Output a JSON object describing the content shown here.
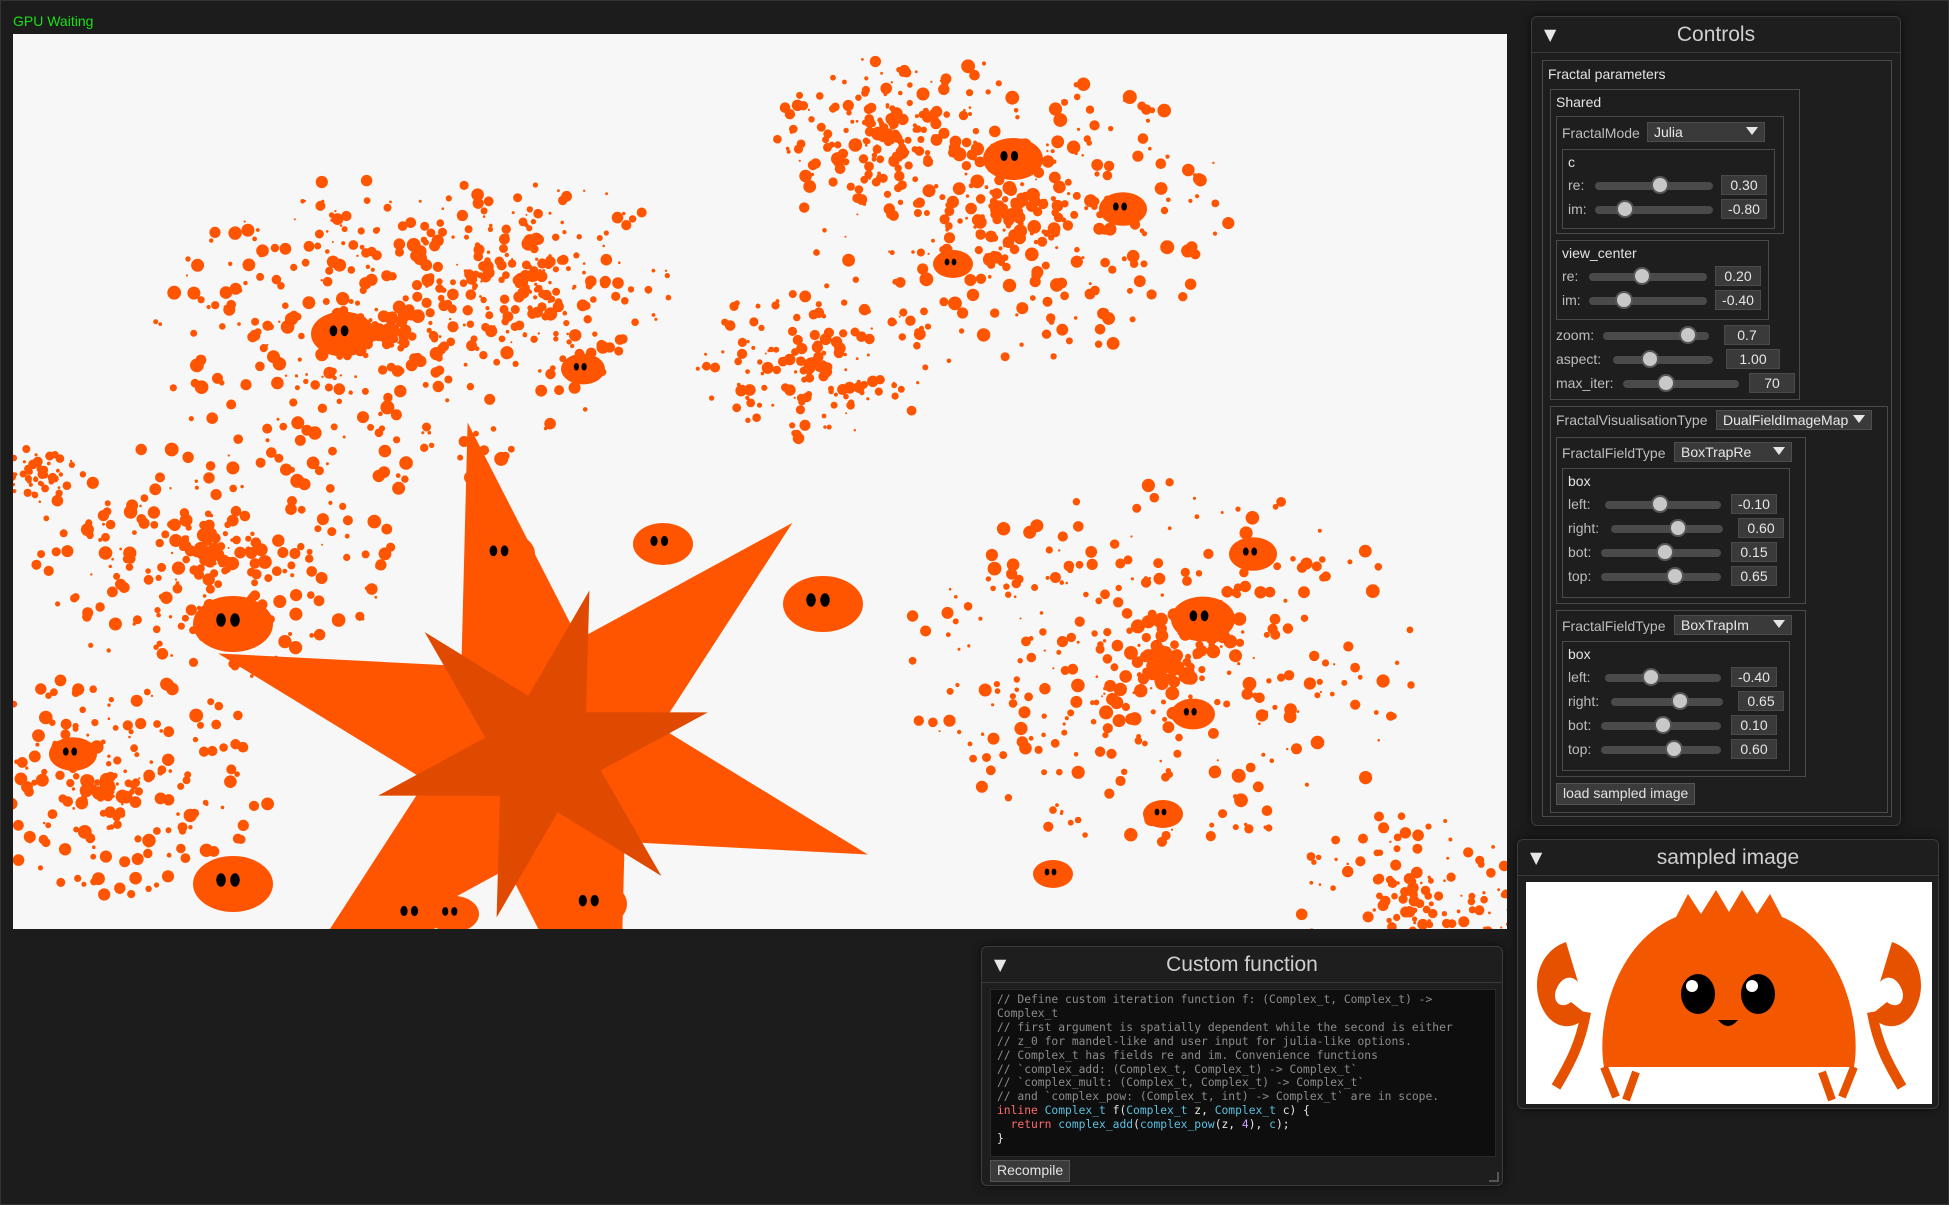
{
  "status": {
    "gpu": "GPU Waiting"
  },
  "controls": {
    "title": "Controls",
    "section_title": "Fractal parameters",
    "shared": {
      "title": "Shared",
      "fractal_mode": {
        "label": "FractalMode",
        "value": "Julia"
      },
      "c": {
        "title": "c",
        "re_label": "re:",
        "re_value": "0.30",
        "im_label": "im:",
        "im_value": "-0.80"
      },
      "view_center": {
        "title": "view_center",
        "re_label": "re:",
        "re_value": "0.20",
        "im_label": "im:",
        "im_value": "-0.40"
      },
      "zoom": {
        "label": "zoom:",
        "value": "0.7"
      },
      "aspect": {
        "label": "aspect:",
        "value": "1.00"
      },
      "max_iter": {
        "label": "max_iter:",
        "value": "70"
      }
    },
    "visualisation": {
      "label": "FractalVisualisationType",
      "value": "DualFieldImageMap"
    },
    "field1": {
      "label": "FractalFieldType",
      "value": "BoxTrapRe",
      "box_title": "box",
      "left_label": "left:",
      "left": "-0.10",
      "right_label": "right:",
      "right": "0.60",
      "bot_label": "bot:",
      "bot": "0.15",
      "top_label": "top:",
      "top": "0.65"
    },
    "field2": {
      "label": "FractalFieldType",
      "value": "BoxTrapIm",
      "box_title": "box",
      "left_label": "left:",
      "left": "-0.40",
      "right_label": "right:",
      "right": "0.65",
      "bot_label": "bot:",
      "bot": "0.10",
      "top_label": "top:",
      "top": "0.60"
    },
    "load_button": "load sampled image"
  },
  "sampled": {
    "title": "sampled image"
  },
  "custom": {
    "title": "Custom function",
    "code": {
      "l1": "// Define custom iteration function f: (Complex_t, Complex_t) ->",
      "l2": "Complex_t",
      "l3": "// first argument is spatially dependent while the second is either",
      "l4": "// z_0 for mandel-like and user input for julia-like options.",
      "l5": "// Complex_t has fields re and im. Convenience functions",
      "l6": "// `complex_add: (Complex_t, Complex_t) -> Complex_t`",
      "l7": "// `complex_mult: (Complex_t, Complex_t) -> Complex_t`",
      "l8": "// and `complex_pow: (Complex_t, int) -> Complex_t` are in scope.",
      "kw_inline": "inline",
      "ty_complex": "Complex_t",
      "sig_rest": " f(",
      "sig_z": " z, ",
      "sig_c": " c) {",
      "kw_return": "return",
      "fn_add": "complex_add",
      "fn_pow": "complex_pow",
      "arg_z": "(z, ",
      "num_4": "4",
      "arg_close": "), ",
      "arg_c": "c",
      "end_paren": ");",
      "close": "}"
    },
    "recompile": "Recompile"
  },
  "colors": {
    "accent": "#ff5500",
    "gpu_status": "#19e019",
    "fractal_bg": "#f7f7f7"
  }
}
